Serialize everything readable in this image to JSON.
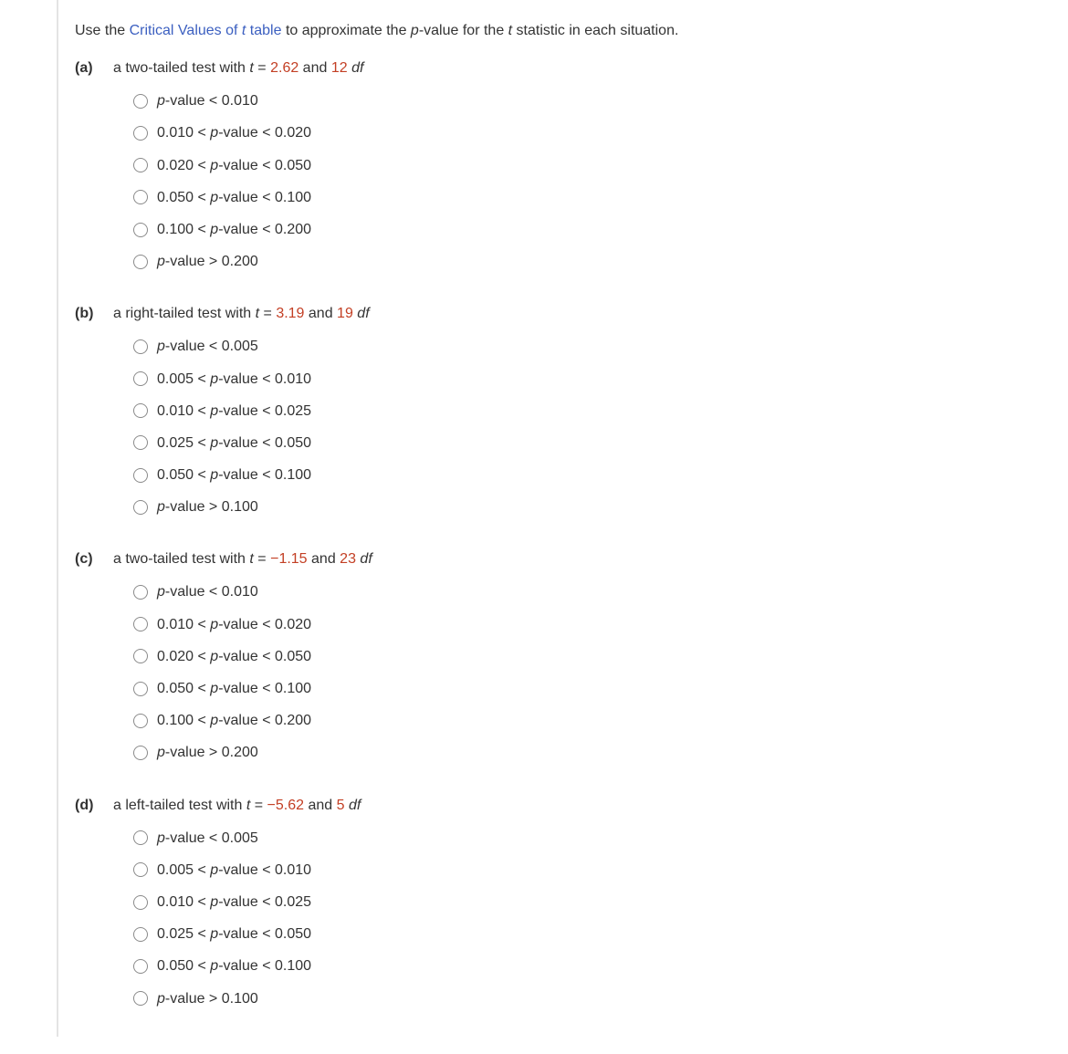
{
  "intro": {
    "pre": "Use the ",
    "link": "Critical Values of ",
    "link_t": "t",
    "link_post": " table",
    "mid": " to approximate the ",
    "pval": "p",
    "mid2": "-value for the ",
    "tstat": "t",
    "post": " statistic in each situation."
  },
  "parts": [
    {
      "label": "(a)",
      "stem_pre": "a two-tailed test with ",
      "stem_t": "t",
      "stem_eq": " = ",
      "stem_val": "2.62",
      "stem_and": " and ",
      "stem_df_val": "12",
      "stem_df": " df",
      "options": [
        {
          "pre": "",
          "p": "p",
          "post": "-value < 0.010"
        },
        {
          "pre": "0.010 < ",
          "p": "p",
          "post": "-value < 0.020"
        },
        {
          "pre": "0.020 < ",
          "p": "p",
          "post": "-value < 0.050"
        },
        {
          "pre": "0.050 < ",
          "p": "p",
          "post": "-value < 0.100"
        },
        {
          "pre": "0.100 < ",
          "p": "p",
          "post": "-value < 0.200"
        },
        {
          "pre": "",
          "p": "p",
          "post": "-value > 0.200"
        }
      ]
    },
    {
      "label": "(b)",
      "stem_pre": "a right-tailed test with ",
      "stem_t": "t",
      "stem_eq": " = ",
      "stem_val": "3.19",
      "stem_and": " and ",
      "stem_df_val": "19",
      "stem_df": " df",
      "options": [
        {
          "pre": "",
          "p": "p",
          "post": "-value < 0.005"
        },
        {
          "pre": "0.005 < ",
          "p": "p",
          "post": "-value < 0.010"
        },
        {
          "pre": "0.010 < ",
          "p": "p",
          "post": "-value < 0.025"
        },
        {
          "pre": "0.025 < ",
          "p": "p",
          "post": "-value < 0.050"
        },
        {
          "pre": "0.050 < ",
          "p": "p",
          "post": "-value < 0.100"
        },
        {
          "pre": "",
          "p": "p",
          "post": "-value > 0.100"
        }
      ]
    },
    {
      "label": "(c)",
      "stem_pre": "a two-tailed test with ",
      "stem_t": "t",
      "stem_eq": " = ",
      "stem_val": "−1.15",
      "stem_and": " and ",
      "stem_df_val": "23",
      "stem_df": " df",
      "options": [
        {
          "pre": "",
          "p": "p",
          "post": "-value < 0.010"
        },
        {
          "pre": "0.010 < ",
          "p": "p",
          "post": "-value < 0.020"
        },
        {
          "pre": "0.020 < ",
          "p": "p",
          "post": "-value < 0.050"
        },
        {
          "pre": "0.050 < ",
          "p": "p",
          "post": "-value < 0.100"
        },
        {
          "pre": "0.100 < ",
          "p": "p",
          "post": "-value < 0.200"
        },
        {
          "pre": "",
          "p": "p",
          "post": "-value > 0.200"
        }
      ]
    },
    {
      "label": "(d)",
      "stem_pre": "a left-tailed test with ",
      "stem_t": "t",
      "stem_eq": " = ",
      "stem_val": "−5.62",
      "stem_and": " and ",
      "stem_df_val": "5",
      "stem_df": " df",
      "options": [
        {
          "pre": "",
          "p": "p",
          "post": "-value < 0.005"
        },
        {
          "pre": "0.005 < ",
          "p": "p",
          "post": "-value < 0.010"
        },
        {
          "pre": "0.010 < ",
          "p": "p",
          "post": "-value < 0.025"
        },
        {
          "pre": "0.025 < ",
          "p": "p",
          "post": "-value < 0.050"
        },
        {
          "pre": "0.050 < ",
          "p": "p",
          "post": "-value < 0.100"
        },
        {
          "pre": "",
          "p": "p",
          "post": "-value > 0.100"
        }
      ]
    }
  ]
}
